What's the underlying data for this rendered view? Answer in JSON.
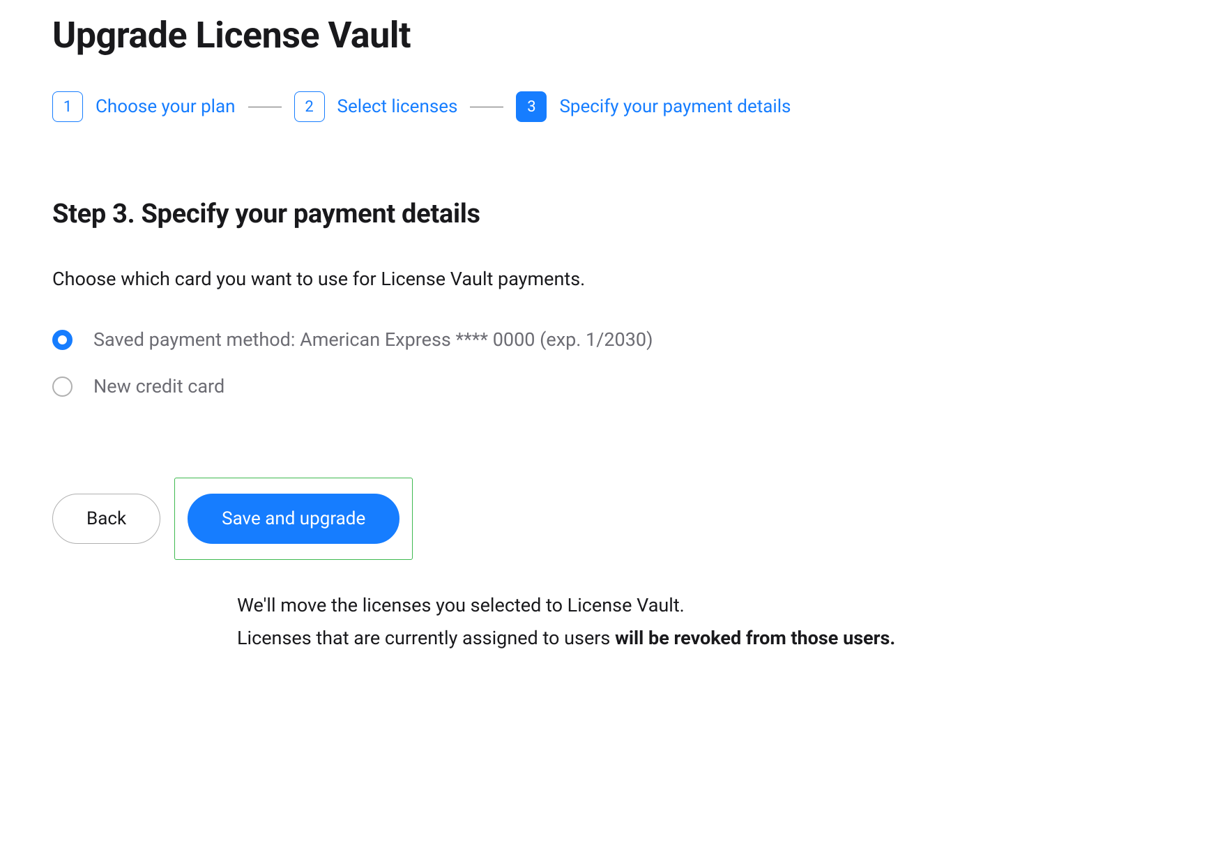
{
  "page": {
    "title": "Upgrade License Vault"
  },
  "stepper": {
    "steps": [
      {
        "num": "1",
        "label": "Choose your plan",
        "active": false
      },
      {
        "num": "2",
        "label": "Select licenses",
        "active": false
      },
      {
        "num": "3",
        "label": "Specify your payment details",
        "active": true
      }
    ]
  },
  "section": {
    "title": "Step 3. Specify your payment details",
    "description": "Choose which card you want to use for License Vault payments."
  },
  "payment_options": {
    "saved": {
      "label": "Saved payment method: American Express **** 0000 (exp. 1/2030)",
      "selected": true
    },
    "new": {
      "label": "New credit card",
      "selected": false
    }
  },
  "buttons": {
    "back": "Back",
    "save": "Save and upgrade"
  },
  "note": {
    "line1": "We'll move the licenses you selected to License Vault.",
    "line2_prefix": "Licenses that are currently assigned to users ",
    "line2_bold": "will be revoked from those users."
  },
  "colors": {
    "accent": "#167dff",
    "highlight_border": "#3fb950"
  }
}
